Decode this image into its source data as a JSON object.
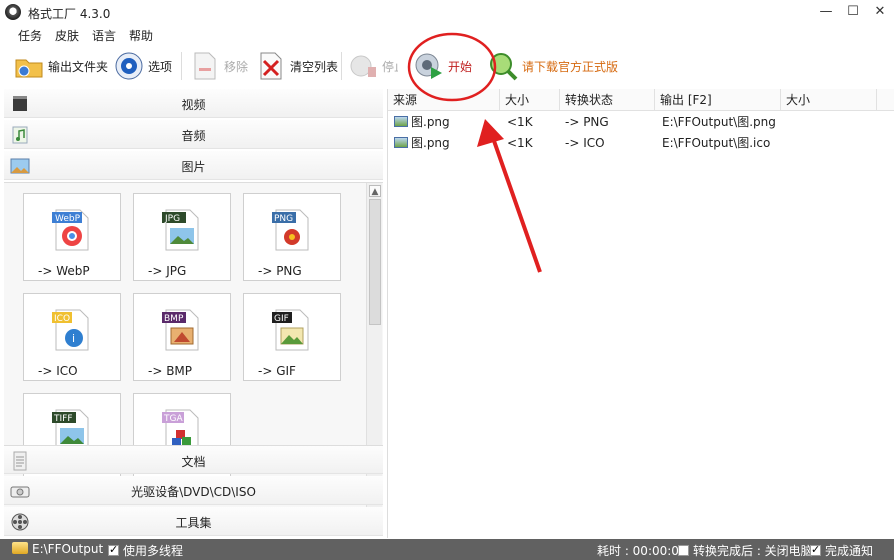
{
  "window": {
    "title": "格式工厂 4.3.0",
    "controls": {
      "minimize": "—",
      "maximize": "☐",
      "close": "✕"
    }
  },
  "menu": [
    "任务",
    "皮肤",
    "语言",
    "帮助"
  ],
  "toolbar": {
    "output_folder": "输出文件夹",
    "options": "选项",
    "remove": "移除",
    "clear_list": "清空列表",
    "stop": "停止",
    "start": "开始",
    "download": "请下载官方正式版"
  },
  "categories": {
    "video": "视频",
    "audio": "音频",
    "image": "图片",
    "document": "文档",
    "disc": "光驱设备\\DVD\\CD\\ISO",
    "tools": "工具集"
  },
  "image_formats": [
    {
      "badge": "WebP",
      "label": "-> WebP"
    },
    {
      "badge": "JPG",
      "label": "-> JPG"
    },
    {
      "badge": "PNG",
      "label": "-> PNG"
    },
    {
      "badge": "ICO",
      "label": "-> ICO"
    },
    {
      "badge": "BMP",
      "label": "-> BMP"
    },
    {
      "badge": "GIF",
      "label": "-> GIF"
    },
    {
      "badge": "TIFF",
      "label": ""
    },
    {
      "badge": "TGA",
      "label": ""
    }
  ],
  "file_list": {
    "columns": [
      "来源",
      "大小",
      "转换状态",
      "输出 [F2]",
      "大小"
    ],
    "rows": [
      {
        "source": "图.png",
        "size": "<1K",
        "status": "-> PNG",
        "output": "E:\\FFOutput\\图.png",
        "out_size": ""
      },
      {
        "source": "图.png",
        "size": "<1K",
        "status": "-> ICO",
        "output": "E:\\FFOutput\\图.ico",
        "out_size": ""
      }
    ]
  },
  "statusbar": {
    "output_path": "E:\\FFOutput",
    "multithread": "使用多线程",
    "elapsed": "耗时 : 00:00:00",
    "after_convert": "转换完成后 : 关闭电脑",
    "notify": "完成通知"
  },
  "colors": {
    "annotation_red": "#e02020",
    "download_orange": "#d66a10",
    "statusbar_bg": "#616161"
  }
}
